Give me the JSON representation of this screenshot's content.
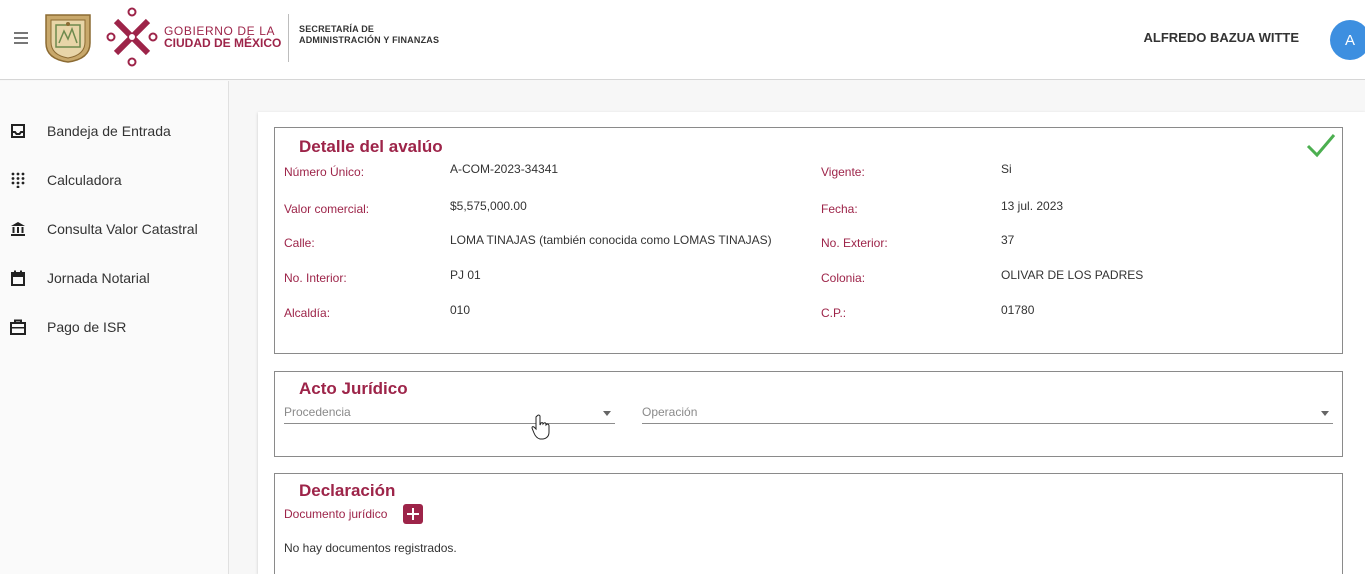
{
  "header": {
    "gov_line1": "GOBIERNO DE LA",
    "gov_line2": "CIUDAD DE MÉXICO",
    "secretaria_line1": "SECRETARÍA DE",
    "secretaria_line2": "ADMINISTRACIÓN Y FINANZAS",
    "user_name": "ALFREDO BAZUA WITTE",
    "avatar_initial": "A",
    "brand_color": "#9d2449",
    "avatar_color": "#3d8fe0"
  },
  "sidebar": {
    "items": [
      {
        "label": "Bandeja de Entrada",
        "icon": "inbox-icon"
      },
      {
        "label": "Calculadora",
        "icon": "dialpad-icon"
      },
      {
        "label": "Consulta Valor Catastral",
        "icon": "bank-icon"
      },
      {
        "label": "Jornada Notarial",
        "icon": "calendar-icon"
      },
      {
        "label": "Pago de ISR",
        "icon": "briefcase-icon"
      }
    ]
  },
  "detalle": {
    "title": "Detalle del avalúo",
    "status_icon": "check-icon",
    "status_color": "#4caf50",
    "fields": [
      {
        "label": "Número Único:",
        "value": "A-COM-2023-34341"
      },
      {
        "label": "Vigente:",
        "value": "Si"
      },
      {
        "label": "Valor comercial:",
        "value": "$5,575,000.00"
      },
      {
        "label": "Fecha:",
        "value": "13 jul. 2023"
      },
      {
        "label": "Calle:",
        "value": "LOMA TINAJAS (también conocida como LOMAS TINAJAS)"
      },
      {
        "label": "No. Exterior:",
        "value": "37"
      },
      {
        "label": "No. Interior:",
        "value": "PJ 01"
      },
      {
        "label": "Colonia:",
        "value": "OLIVAR DE LOS PADRES"
      },
      {
        "label": "Alcaldía:",
        "value": "010"
      },
      {
        "label": "C.P.:",
        "value": "01780"
      }
    ]
  },
  "acto": {
    "title": "Acto Jurídico",
    "procedencia_placeholder": "Procedencia",
    "operacion_placeholder": "Operación"
  },
  "declaracion": {
    "title": "Declaración",
    "documento_label": "Documento jurídico",
    "empty_message": "No hay documentos registrados."
  }
}
